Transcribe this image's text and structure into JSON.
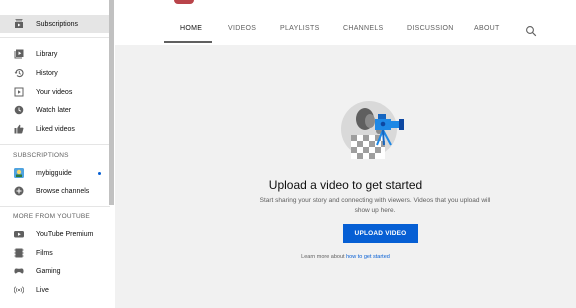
{
  "sidebar": {
    "top_items": [
      {
        "label": "Subscriptions",
        "icon": "subscriptions-icon"
      }
    ],
    "library_items": [
      {
        "label": "Library",
        "icon": "library-icon"
      },
      {
        "label": "History",
        "icon": "history-icon"
      },
      {
        "label": "Your videos",
        "icon": "your-videos-icon"
      },
      {
        "label": "Watch later",
        "icon": "watch-later-icon"
      },
      {
        "label": "Liked videos",
        "icon": "thumbs-up-icon"
      }
    ],
    "subscriptions_heading": "SUBSCRIPTIONS",
    "subscriptions": [
      {
        "label": "mybigguide",
        "icon": "channel-avatar"
      },
      {
        "label": "Browse channels",
        "icon": "add-circle-icon"
      }
    ],
    "more_heading": "MORE FROM YOUTUBE",
    "more_items": [
      {
        "label": "YouTube Premium",
        "icon": "youtube-icon"
      },
      {
        "label": "Films",
        "icon": "film-icon"
      },
      {
        "label": "Gaming",
        "icon": "gaming-icon"
      },
      {
        "label": "Live",
        "icon": "live-icon"
      }
    ]
  },
  "tabs": [
    {
      "label": "HOME"
    },
    {
      "label": "VIDEOS"
    },
    {
      "label": "PLAYLISTS"
    },
    {
      "label": "CHANNELS"
    },
    {
      "label": "DISCUSSION"
    },
    {
      "label": "ABOUT"
    }
  ],
  "empty_state": {
    "title": "Upload a video to get started",
    "description": "Start sharing your story and connecting with viewers. Videos that you upload will show up here.",
    "button_label": "UPLOAD VIDEO",
    "learn_prefix": "Learn more about",
    "learn_link": "how to get started"
  },
  "colors": {
    "accent": "#065fd4",
    "main_bg": "#f1f1f1",
    "active_item_bg": "#e5e5e5"
  }
}
